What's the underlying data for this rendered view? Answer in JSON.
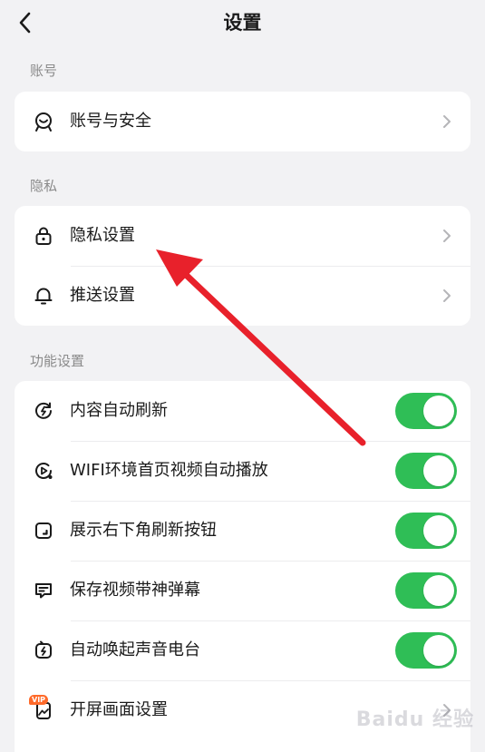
{
  "header": {
    "title": "设置"
  },
  "sections": [
    {
      "label": "账号"
    },
    {
      "label": "隐私"
    },
    {
      "label": "功能设置"
    }
  ],
  "account_rows": [
    {
      "label": "账号与安全",
      "icon": "account-face-icon"
    }
  ],
  "privacy_rows": [
    {
      "label": "隐私设置",
      "icon": "lock-icon"
    },
    {
      "label": "推送设置",
      "icon": "bell-icon"
    }
  ],
  "feature_rows": [
    {
      "label": "内容自动刷新",
      "icon": "refresh-circle-icon",
      "toggle_on": true
    },
    {
      "label": "WIFI环境首页视频自动播放",
      "icon": "play-circle-icon",
      "toggle_on": true
    },
    {
      "label": "展示右下角刷新按钮",
      "icon": "corner-square-icon",
      "toggle_on": true
    },
    {
      "label": "保存视频带神弹幕",
      "icon": "danmaku-icon",
      "toggle_on": true
    },
    {
      "label": "自动唤起声音电台",
      "icon": "radio-icon",
      "toggle_on": true
    },
    {
      "label": "开屏画面设置",
      "icon": "splash-image-icon",
      "badge": "VIP"
    }
  ],
  "watermark": "Baidu 经验",
  "colors": {
    "toggle_on": "#2fbe56",
    "arrow": "#e8212b",
    "vip_badge": "#ff6a2a"
  }
}
